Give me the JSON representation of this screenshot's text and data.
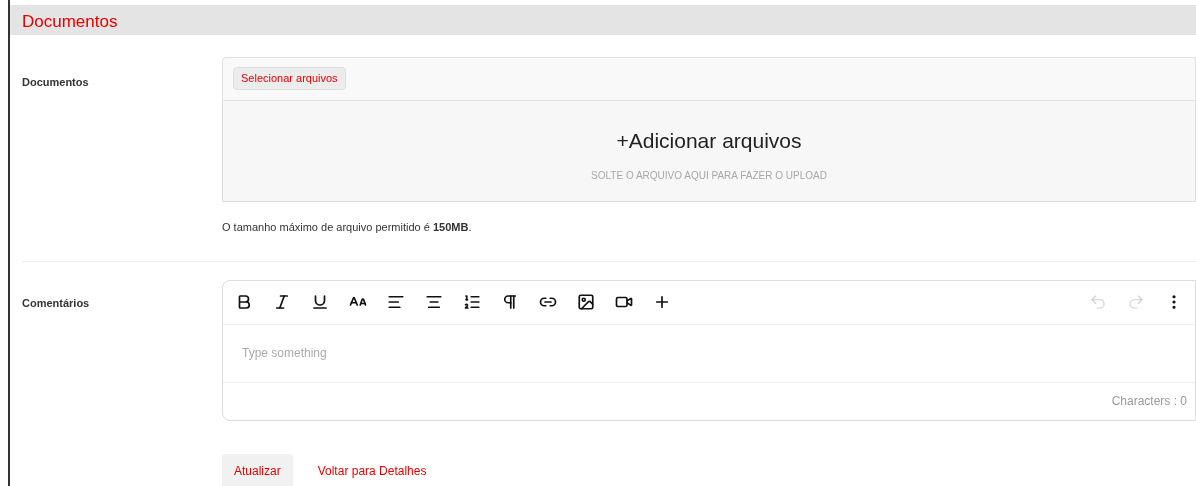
{
  "header": {
    "title": "Documentos"
  },
  "documents": {
    "label": "Documentos",
    "select_button": "Selecionar arquivos",
    "drop_title": "+Adicionar arquivos",
    "drop_hint": "SOLTE O ARQUIVO AQUI PARA FAZER O UPLOAD",
    "note": "O tamanho máximo de arquivo permitido é **150MB**."
  },
  "comments": {
    "label": "Comentários",
    "toolbar": [
      {
        "kind": "bold",
        "disabled": false
      },
      {
        "kind": "italic",
        "disabled": false
      },
      {
        "kind": "underline",
        "disabled": false
      },
      {
        "kind": "font-size",
        "disabled": false
      },
      {
        "kind": "align-left",
        "disabled": false
      },
      {
        "kind": "align-center",
        "disabled": false
      },
      {
        "kind": "ordered-list",
        "disabled": false
      },
      {
        "kind": "paragraph",
        "disabled": false
      },
      {
        "kind": "link",
        "disabled": false
      },
      {
        "kind": "image",
        "disabled": false
      },
      {
        "kind": "video",
        "disabled": false
      },
      {
        "kind": "insert",
        "disabled": false
      }
    ],
    "toolbar_right": [
      {
        "kind": "undo",
        "disabled": true
      },
      {
        "kind": "redo",
        "disabled": true
      },
      {
        "kind": "more",
        "disabled": false
      }
    ],
    "placeholder": "Type something",
    "counter": "Characters : 0"
  },
  "actions": [
    {
      "label": "Atualizar",
      "kind": "button"
    },
    {
      "label": "Voltar para Detalhes",
      "kind": "link"
    }
  ]
}
